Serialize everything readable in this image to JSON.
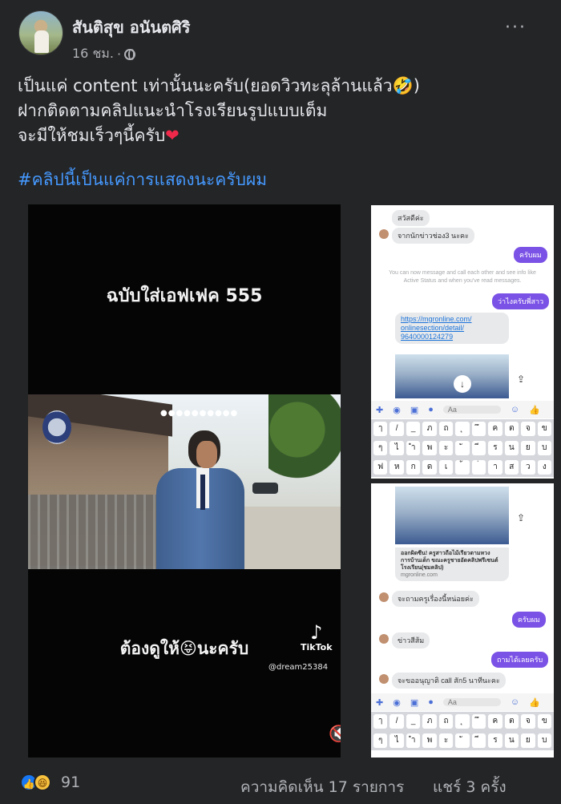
{
  "post": {
    "author": "สันติสุข อนันตศิริ",
    "time": "16 ชม.",
    "dot": "·",
    "more": "···",
    "lines": [
      "เป็นแค่ content เท่านั้นนะครับ(ยอดวิวทะลุล้านแล้ว🤣)",
      "ฝากติดตามคลิปแนะนำโรงเรียนรูปแบบเต็ม",
      "จะมีให้ชมเร็วๆนี้ครับ"
    ],
    "heart": "❤",
    "hashtag": "#คลิปนี้เป็นแค่การแสดงนะครับผม"
  },
  "video": {
    "caption_top": "ฉบับใส่เอฟเฟค 555",
    "caption_bottom": "ต้องดูให้😝นะครับ",
    "tiktok_brand": "TikTok",
    "handle": "@dream25384",
    "scene_dots": "●●●●●●●●●●"
  },
  "screenshot1": {
    "greet": "สวัสดีค่ะ",
    "msg1": "จากนักข่าวช่อง3 นะคะ",
    "reply1": "ครับผม",
    "info": "You can now message and call each other and see info like Active Status and when you've read messages.",
    "reply2": "ว่าไงครับพี่สาว",
    "link_lines": [
      "https://mgronline.com/",
      "onlinesection/detail/",
      "9640000124279"
    ],
    "input_placeholder": "Aa"
  },
  "screenshot2": {
    "article": "ออกผิดซีน! ครูสาวถือไม้เรียวตามหวงการบ้านเด็ก ขณะครูชายอัดคลิปพรีเซนต์โรงเรียน(ชมคลิป)",
    "domain": "mgronline.com",
    "msg1": "จะถามครูเรื่องนี้หน่อยค่ะ",
    "reply1": "ครับผม",
    "msg2": "ข่าวสีส้ม",
    "reply2": "ถามได้เลยครับ",
    "msg3": "จะขออนุญาติ call สัก5 นาทีนะคะ",
    "input_placeholder": "Aa"
  },
  "keyboard": {
    "row1": [
      "ๅ",
      "/",
      "_",
      "ภ",
      "ถ",
      "ุ",
      "ึ",
      "ค",
      "ต",
      "จ",
      "ข"
    ],
    "row2": [
      "ๆ",
      "ไ",
      "ำ",
      "พ",
      "ะ",
      "ั",
      "ี",
      "ร",
      "น",
      "ย",
      "บ"
    ],
    "row3": [
      "ฟ",
      "ห",
      "ก",
      "ด",
      "เ",
      "้",
      "่",
      "า",
      "ส",
      "ว",
      "ง"
    ]
  },
  "footer": {
    "reaction_count": "91",
    "comments": "ความคิดเห็น 17 รายการ",
    "shares": "แชร์ 3 ครั้ง"
  },
  "colors": {
    "background": "#242526",
    "hashtag": "#4599ff",
    "messenger_accent": "#7b52e6",
    "like_blue": "#1877f2"
  }
}
